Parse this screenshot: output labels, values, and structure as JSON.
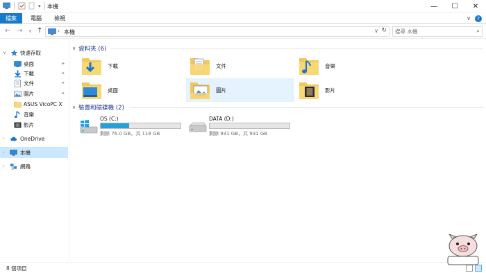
{
  "window": {
    "title": "本機",
    "minimize": "—",
    "maximize": "☐",
    "close": "✕"
  },
  "ribbon": {
    "tabs": [
      "檔案",
      "電腦",
      "檢視"
    ],
    "expand": "∨"
  },
  "navigation": {
    "back": "←",
    "forward": "→",
    "recent": "∨",
    "up": "↑"
  },
  "address": {
    "chevron": "›",
    "crumb": "本機",
    "dropdown": "∨",
    "refresh": "↻"
  },
  "search": {
    "placeholder": "搜尋 本機",
    "icon": "search-icon"
  },
  "sidebar": {
    "quick_access": "快速存取",
    "quick_items": [
      {
        "label": "桌面",
        "icon": "desktop-icon",
        "pinned": true
      },
      {
        "label": "下載",
        "icon": "download-icon",
        "pinned": true
      },
      {
        "label": "文件",
        "icon": "documents-icon",
        "pinned": true
      },
      {
        "label": "圖片",
        "icon": "pictures-icon",
        "pinned": true
      },
      {
        "label": "ASUS VicoPC X",
        "icon": "folder-icon",
        "pinned": false
      },
      {
        "label": "音樂",
        "icon": "music-icon",
        "pinned": false
      },
      {
        "label": "影片",
        "icon": "videos-icon",
        "pinned": false
      }
    ],
    "onedrive": "OneDrive",
    "this_pc": "本機",
    "network": "網路",
    "expand_glyph": "›",
    "expanded_glyph": "∨",
    "pin_glyph": "✦"
  },
  "folders": {
    "header": "資料夾 (6)",
    "items": [
      {
        "label": "下載",
        "icon": "download-folder-icon"
      },
      {
        "label": "文件",
        "icon": "documents-folder-icon"
      },
      {
        "label": "音樂",
        "icon": "music-folder-icon"
      },
      {
        "label": "桌面",
        "icon": "desktop-folder-icon"
      },
      {
        "label": "圖片",
        "icon": "pictures-folder-icon",
        "selected": true
      },
      {
        "label": "影片",
        "icon": "videos-folder-icon"
      }
    ]
  },
  "drives": {
    "header": "裝置和磁碟機 (2)",
    "items": [
      {
        "label": "OS (C:)",
        "info": "剩餘 76.0 GB，共 118 GB",
        "used_fraction": 0.36,
        "icon": "windows-drive-icon"
      },
      {
        "label": "DATA (D:)",
        "info": "剩餘 931 GB，共 931 GB",
        "used_fraction": 0.0,
        "icon": "hard-drive-icon"
      }
    ]
  },
  "status": {
    "count": "8 個項目"
  },
  "colors": {
    "accent": "#1979ca",
    "selection": "#cce8ff",
    "hover": "#e5f3ff",
    "group_header": "#1e3287",
    "drive_bar": "#26a0da",
    "folder": "#f8d775"
  }
}
